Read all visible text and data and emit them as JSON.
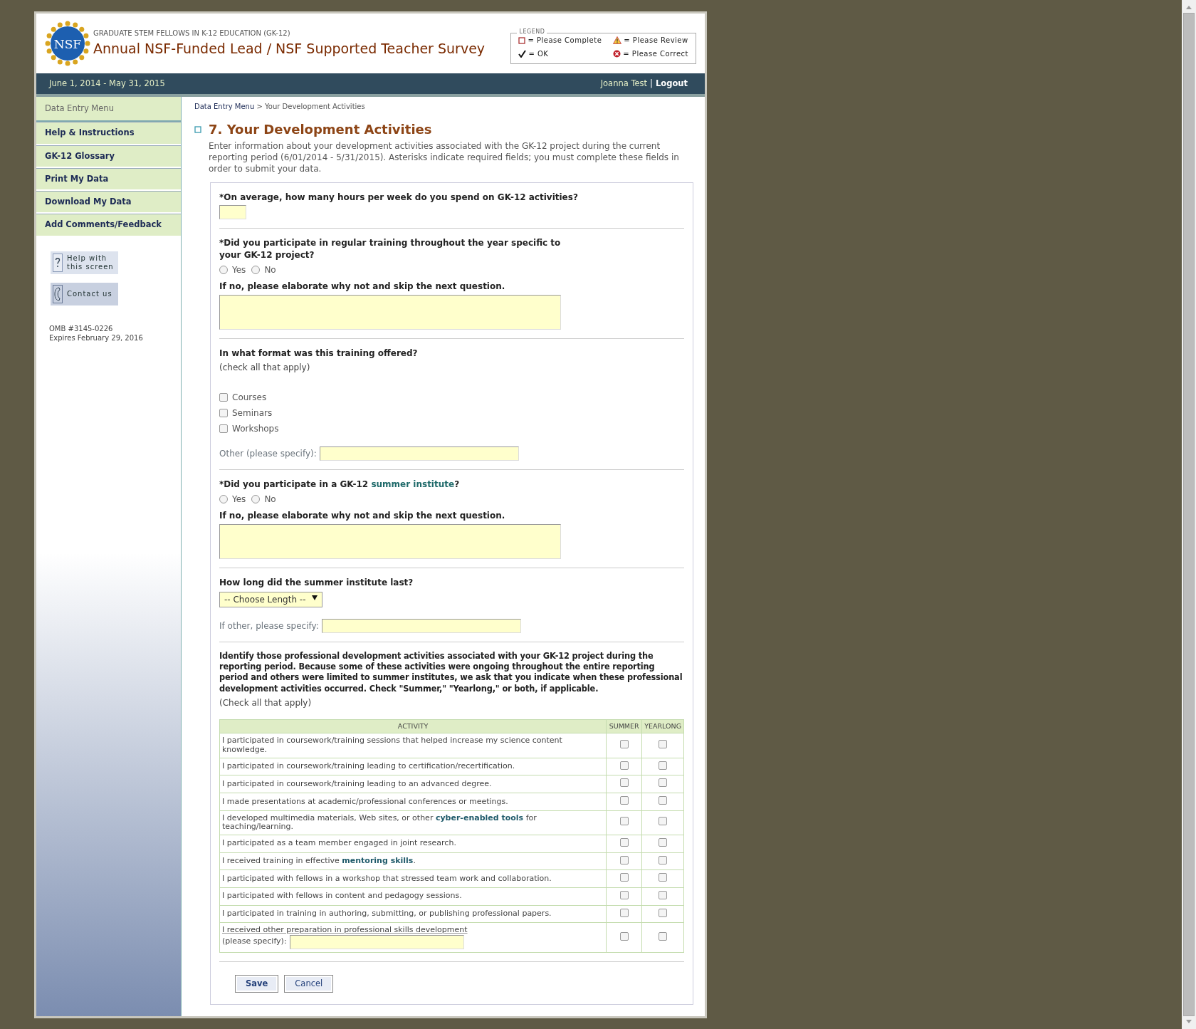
{
  "header": {
    "logo_text": "NSF",
    "subtitle": "GRADUATE STEM FELLOWS IN K-12 EDUCATION (GK-12)",
    "title": "Annual NSF-Funded Lead / NSF Supported Teacher Survey"
  },
  "legend": {
    "title": "LEGEND",
    "items": [
      {
        "kind": "complete",
        "label": "= Please Complete"
      },
      {
        "kind": "review",
        "label": "= Please Review"
      },
      {
        "kind": "ok",
        "label": "= OK"
      },
      {
        "kind": "correct",
        "label": "= Please Correct"
      }
    ]
  },
  "topbar": {
    "period": "June 1, 2014 - May 31, 2015",
    "user": "Joanna Test",
    "separator": "|",
    "logout": "Logout"
  },
  "sidebar": {
    "menu_title": "Data Entry Menu",
    "items": [
      "Help & Instructions",
      "GK-12 Glossary",
      "Print My Data",
      "Download My Data",
      "Add Comments/Feedback"
    ],
    "buttons": [
      {
        "kind": "help",
        "label": "Help with this screen"
      },
      {
        "kind": "contact",
        "label": "Contact us"
      }
    ],
    "omb": [
      "OMB #3145-0226",
      "Expires February 29, 2016"
    ]
  },
  "breadcrumb": {
    "link": "Data Entry Menu",
    "separator": ">",
    "current": "Your Development Activities"
  },
  "section": {
    "title": "7. Your Development Activities",
    "intro": "Enter information about your development activities associated with the GK-12 project during the current reporting period (6/01/2014 - 5/31/2015). Asterisks indicate required fields; you must complete these fields in order to submit your data."
  },
  "questions": [
    {
      "kind": "text",
      "label": [
        {
          "text": "*On average, how many hours per week do you spend on GK-12 activities?",
          "link": false
        }
      ]
    },
    {
      "kind": "radio",
      "label": [
        {
          "text": "*Did you participate in regular training throughout the year specific to your GK-12 project?",
          "link": false
        }
      ],
      "options": [
        {
          "label": "Yes",
          "selected": false
        },
        {
          "label": "No",
          "selected": false
        }
      ],
      "followup": "If no, please elaborate why not and skip the next question."
    },
    {
      "kind": "checkbox",
      "label": [
        {
          "text": "In what format was this training offered?",
          "link": false
        }
      ],
      "hint": "(check all that apply)",
      "options": [
        {
          "label": "Courses",
          "checked": false
        },
        {
          "label": "Seminars",
          "checked": false
        },
        {
          "label": "Workshops",
          "checked": false
        }
      ],
      "other_label": "Other (please specify):"
    },
    {
      "kind": "radio",
      "label": [
        {
          "text": "*Did you participate in a GK-12 ",
          "link": false
        },
        {
          "text": "summer institute",
          "link": true
        },
        {
          "text": "?",
          "link": false
        }
      ],
      "options": [
        {
          "label": "Yes",
          "selected": false
        },
        {
          "label": "No",
          "selected": false
        }
      ],
      "followup": "If no, please elaborate why not and skip the next question."
    },
    {
      "kind": "select",
      "label": [
        {
          "text": "How long did the summer institute last?",
          "link": false
        }
      ],
      "value": "-- Choose Length --",
      "other_label": "If other, please specify:"
    },
    {
      "kind": "table",
      "label": [
        {
          "text": "Identify those professional development activities associated with your GK-12 project during the reporting period. Because some of these activities were ongoing throughout the entire reporting period and others were limited to summer institutes, we ask that you indicate when these professional development activities occurred. Check \"Summer,\" \"Yearlong,\" or both, if applicable.",
          "link": false
        }
      ],
      "hint": "(Check all that apply)",
      "columns": [
        "ACTIVITY",
        "SUMMER",
        "YEARLONG"
      ],
      "rows": [
        {
          "kind": "plain",
          "text": [
            {
              "text": "I participated in coursework/training sessions that helped increase my science content knowledge.",
              "link": false
            }
          ],
          "summer": false,
          "yearlong": false
        },
        {
          "kind": "plain",
          "text": [
            {
              "text": "I participated in coursework/training leading to certification/recertification.",
              "link": false
            }
          ],
          "summer": false,
          "yearlong": false
        },
        {
          "kind": "plain",
          "text": [
            {
              "text": "I participated in coursework/training leading to an advanced degree.",
              "link": false
            }
          ],
          "summer": false,
          "yearlong": false
        },
        {
          "kind": "plain",
          "text": [
            {
              "text": "I made presentations at academic/professional conferences or meetings.",
              "link": false
            }
          ],
          "summer": false,
          "yearlong": false
        },
        {
          "kind": "plain",
          "text": [
            {
              "text": "I developed multimedia materials, Web sites, or other ",
              "link": false
            },
            {
              "text": "cyber-enabled tools",
              "link": true
            },
            {
              "text": " for teaching/learning.",
              "link": false
            }
          ],
          "summer": false,
          "yearlong": false
        },
        {
          "kind": "plain",
          "text": [
            {
              "text": "I participated as a team member engaged in joint research.",
              "link": false
            }
          ],
          "summer": false,
          "yearlong": false
        },
        {
          "kind": "plain",
          "text": [
            {
              "text": "I received training in effective ",
              "link": false
            },
            {
              "text": "mentoring skills",
              "link": true
            },
            {
              "text": ".",
              "link": false
            }
          ],
          "summer": false,
          "yearlong": false
        },
        {
          "kind": "plain",
          "text": [
            {
              "text": "I participated with fellows in a workshop that stressed team work and collaboration.",
              "link": false
            }
          ],
          "summer": false,
          "yearlong": false
        },
        {
          "kind": "plain",
          "text": [
            {
              "text": "I participated with fellows in content and pedagogy sessions.",
              "link": false
            }
          ],
          "summer": false,
          "yearlong": false
        },
        {
          "kind": "plain",
          "text": [
            {
              "text": "I participated in training in authoring, submitting, or publishing professional papers.",
              "link": false
            }
          ],
          "summer": false,
          "yearlong": false
        },
        {
          "kind": "specify",
          "text": [
            {
              "text": "I received other preparation in professional skills development",
              "link": false
            }
          ],
          "specify_label": "(please specify):",
          "summer": false,
          "yearlong": false
        }
      ]
    }
  ],
  "buttons": [
    {
      "kind": "save",
      "label": "Save"
    },
    {
      "kind": "cancel",
      "label": "Cancel"
    }
  ]
}
